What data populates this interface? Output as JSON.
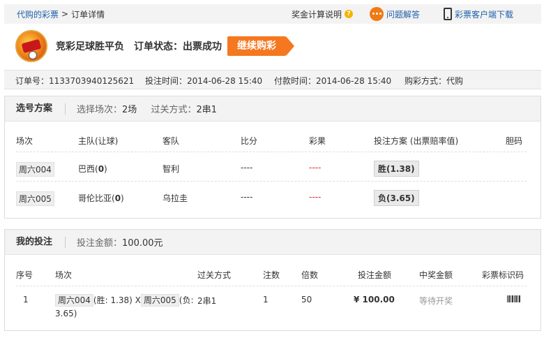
{
  "breadcrumb": {
    "root": "代购的彩票",
    "sep": ">",
    "current": "订单详情"
  },
  "toplinks": {
    "calc": "奖金计算说明",
    "help": "问题解答",
    "download": "彩票客户端下载"
  },
  "header": {
    "lottery_name": "竞彩足球胜平负",
    "status_label": "订单状态：",
    "status_value": "出票成功",
    "continue_button": "继续购彩"
  },
  "order": {
    "number": "订单号：1133703940125621",
    "bet_time": "投注时间：2014-06-28 15:40",
    "pay_time": "付款时间：2014-06-28 15:40",
    "method": "购彩方式：代购"
  },
  "selection": {
    "title": "选号方案",
    "matches_label": "选择场次：",
    "matches_value": "2场",
    "pass_label": "过关方式：",
    "pass_value": "2串1",
    "headers": [
      "场次",
      "主队(让球)",
      "客队",
      "比分",
      "彩果",
      "投注方案 (出票赔率值)",
      "胆码"
    ],
    "rows": [
      {
        "match": "周六004",
        "home": "巴西(",
        "handicap": "0",
        "home_end": ")",
        "away": "智利",
        "score": "----",
        "result": "----",
        "bet": "胜(1.38)"
      },
      {
        "match": "周六005",
        "home": "哥伦比亚(",
        "handicap": "0",
        "home_end": ")",
        "away": "乌拉圭",
        "score": "----",
        "result": "----",
        "bet": "负(3.65)"
      }
    ]
  },
  "mybet": {
    "title": "我的投注",
    "amount_label": "投注金额：",
    "amount_value": "100.00元",
    "headers": [
      "序号",
      "场次",
      "过关方式",
      "注数",
      "倍数",
      "投注金额",
      "中奖金额",
      "彩票标识码"
    ],
    "row": {
      "index": "1",
      "m1": "周六004",
      "m1_bet": "(胜: 1.38) X",
      "m2": "周六005",
      "m2_bet": "(负:",
      "m2_bet_cont": "3.65)",
      "pass": "2串1",
      "count": "1",
      "multiple": "50",
      "amount": "¥ 100.00",
      "prize": "等待开奖"
    }
  }
}
